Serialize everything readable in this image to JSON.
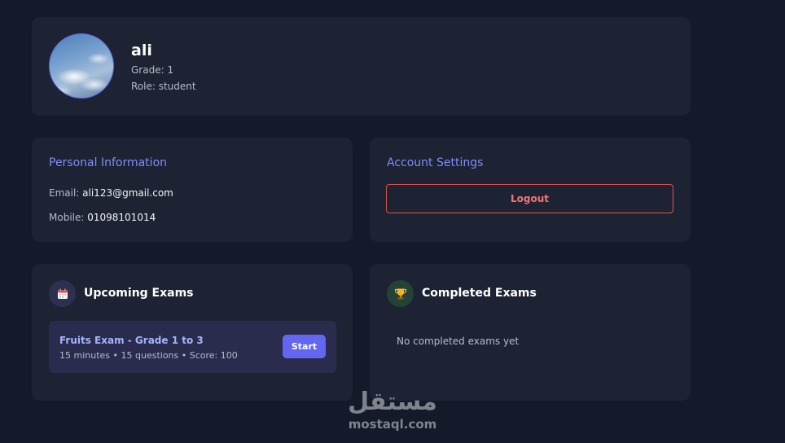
{
  "profile": {
    "name": "ali",
    "grade": "Grade: 1",
    "role": "Role: student"
  },
  "personal_info": {
    "title": "Personal Information",
    "email_label": "Email: ",
    "email": "ali123@gmail.com",
    "mobile_label": "Mobile: ",
    "mobile": "01098101014"
  },
  "account_settings": {
    "title": "Account Settings",
    "logout_label": "Logout"
  },
  "upcoming_exams": {
    "heading": "Upcoming Exams",
    "icon": "calendar-icon",
    "items": [
      {
        "title": "Fruits Exam  - Grade 1 to 3",
        "details": "15 minutes • 15 questions • Score: 100",
        "action_label": "Start"
      }
    ]
  },
  "completed_exams": {
    "heading": "Completed Exams",
    "icon": "trophy-icon",
    "empty_text": "No completed exams yet"
  },
  "watermark": {
    "arabic": "مستقل",
    "latin": "mostaql.com"
  },
  "colors": {
    "background": "#141a29",
    "card": "#1d2333",
    "accent": "#6366f1",
    "danger": "#e05252"
  }
}
